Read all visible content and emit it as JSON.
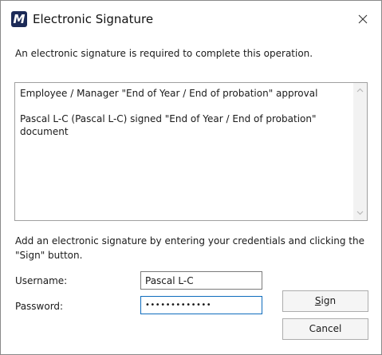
{
  "window": {
    "title": "Electronic Signature",
    "app_icon_letter": "M",
    "app_icon_color": "#1c2a57"
  },
  "intro_text": "An electronic signature is required to complete this operation.",
  "message": {
    "line1": "Employee / Manager \"End of Year / End of probation\" approval",
    "line2": "Pascal L-C (Pascal L-C) signed \"End of Year / End of probation\" document"
  },
  "instruction_text": "Add an electronic signature by entering your credentials and clicking the \"Sign\" button.",
  "form": {
    "username_label": "Username:",
    "username_value": "Pascal L-C",
    "password_label": "Password:",
    "password_value": "•••••••••••••"
  },
  "buttons": {
    "sign_label_first": "S",
    "sign_label_rest": "ign",
    "cancel_label": "Cancel"
  },
  "icons": {
    "close": "close-icon",
    "scroll_up": "chevron-up-icon",
    "scroll_down": "chevron-down-icon"
  },
  "colors": {
    "focus_border": "#0f6cbd"
  }
}
